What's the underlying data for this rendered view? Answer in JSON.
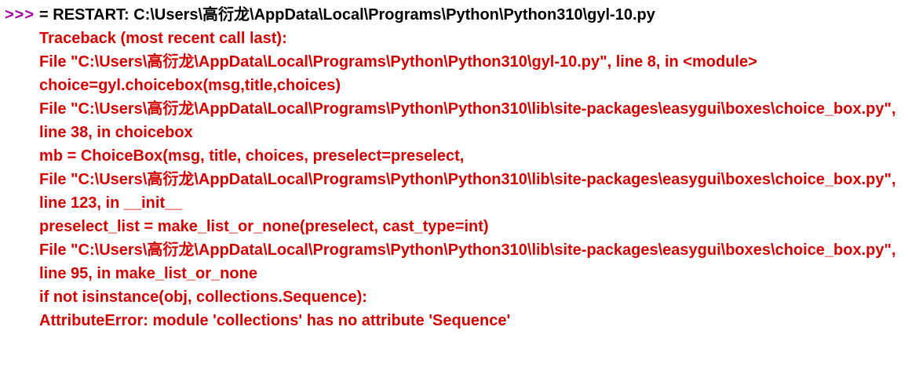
{
  "prompt": ">>>",
  "restart_line": "= RESTART: C:\\Users\\高衍龙\\AppData\\Local\\Programs\\Python\\Python310\\gyl-10.py",
  "traceback": {
    "header": "Traceback (most recent call last):",
    "line1": "  File \"C:\\Users\\高衍龙\\AppData\\Local\\Programs\\Python\\Python310\\gyl-10.py\", line 8, in <module>",
    "line2": "    choice=gyl.choicebox(msg,title,choices)",
    "line3": "  File \"C:\\Users\\高衍龙\\AppData\\Local\\Programs\\Python\\Python310\\lib\\site-packages\\easygui\\boxes\\choice_box.py\", line 38, in choicebox",
    "line4": "    mb = ChoiceBox(msg, title, choices, preselect=preselect,",
    "line5": "  File \"C:\\Users\\高衍龙\\AppData\\Local\\Programs\\Python\\Python310\\lib\\site-packages\\easygui\\boxes\\choice_box.py\", line 123, in __init__",
    "line6": "    preselect_list = make_list_or_none(preselect, cast_type=int)",
    "line7": "  File \"C:\\Users\\高衍龙\\AppData\\Local\\Programs\\Python\\Python310\\lib\\site-packages\\easygui\\boxes\\choice_box.py\", line 95, in make_list_or_none",
    "line8": "    if not isinstance(obj, collections.Sequence):",
    "error": "AttributeError: module 'collections' has no attribute 'Sequence'"
  }
}
